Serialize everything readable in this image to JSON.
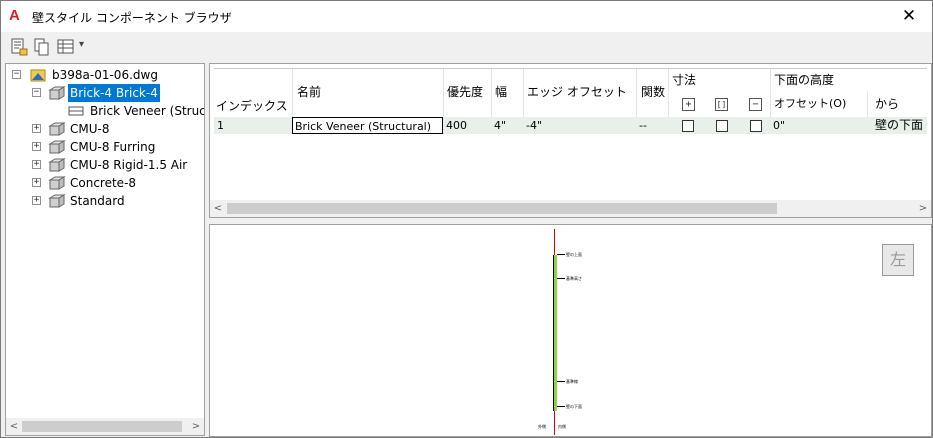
{
  "window": {
    "title": "壁スタイル コンポーネント ブラウザ",
    "app_icon": "A",
    "close_glyph": "✕"
  },
  "toolbar": {
    "icons": [
      "style-list-icon",
      "copy-icon",
      "view-options-icon"
    ],
    "dropdown_glyph": "▾"
  },
  "tree": {
    "root": {
      "label": "b398a-01-06.dwg",
      "expander": "−"
    },
    "selected": {
      "label": "Brick-4 Brick-4",
      "expander": "−"
    },
    "child": {
      "label": "Brick Veneer (Structura"
    },
    "items": [
      {
        "label": "CMU-8",
        "expander": "+"
      },
      {
        "label": "CMU-8 Furring",
        "expander": "+"
      },
      {
        "label": "CMU-8 Rigid-1.5 Air",
        "expander": "+"
      },
      {
        "label": "Concrete-8",
        "expander": "+"
      },
      {
        "label": "Standard",
        "expander": "+"
      }
    ],
    "scroll_left": "<",
    "scroll_right": ">"
  },
  "grid": {
    "headers": {
      "index": "インデックス",
      "name": "名前",
      "priority": "優先度",
      "width": "幅",
      "edge_offset": "エッジ オフセット",
      "function": "関数",
      "dimension": "寸法",
      "bottom_elevation": "下面の高度",
      "offset": "オフセット(O)",
      "from": "から"
    },
    "dimension_icons": [
      "+",
      "[]",
      "−"
    ],
    "rows": [
      {
        "index": "1",
        "name": "Brick Veneer (Structural)",
        "priority": "400",
        "width": "4\"",
        "edge_offset": "-4\"",
        "function": "--",
        "offset": "0\"",
        "from": "壁の下面"
      }
    ],
    "scroll_left": "<",
    "scroll_right": ">"
  },
  "preview": {
    "side_button": "左",
    "labels": [
      "壁の上面",
      "基準高さ",
      "基準線",
      "壁の下面"
    ],
    "bottom_labels": [
      "外側",
      "内側"
    ],
    "colors": {
      "wall": "#8ad34a",
      "baseline": "#e00000"
    }
  }
}
